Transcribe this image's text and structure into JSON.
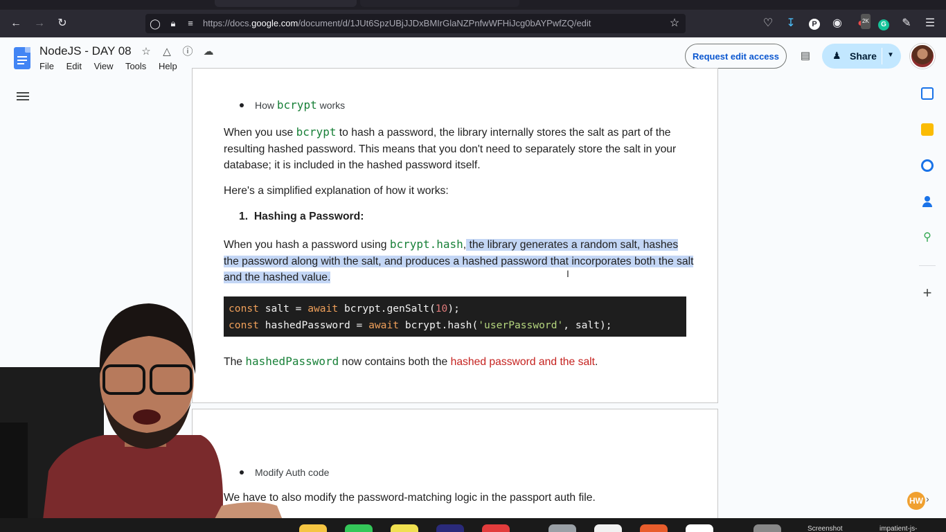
{
  "browser": {
    "url_prefix": "https://docs.",
    "url_domain": "google.com",
    "url_path": "/document/d/1JUt6SpzUBjJJDxBMIrGlaNZPnfwWFHiJcg0bAYPwfZQ/edit",
    "extension_badge": "2K"
  },
  "docs": {
    "title": "NodeJS - DAY 08",
    "menu": [
      "File",
      "Edit",
      "View",
      "Tools",
      "Help"
    ],
    "request_edit_label": "Request edit access",
    "share_label": "Share"
  },
  "content": {
    "bullet1_prefix": "How ",
    "bullet1_code": "bcrypt",
    "bullet1_suffix": " works",
    "p1_a": "When you use ",
    "p1_code": "bcrypt",
    "p1_b": " to hash a password, the library internally stores the salt as part of the resulting hashed password. This means that you don't need to separately store the salt in your database; it is included in the hashed password itself.",
    "p2": "Here's a simplified explanation of how it works:",
    "list_num": "1.",
    "list_item": "Hashing a Password:",
    "p3_a": "When you hash a password using ",
    "p3_code": "bcrypt.hash",
    "p3_b": ",",
    "p3_sel": " the library generates a random salt, hashes the password along with the salt, and produces a hashed password that incorporates both the salt and the hashed value.",
    "code_line1": {
      "kw1": "const",
      "mid1": " salt = ",
      "kw2": "await",
      "mid2": " bcrypt.genSalt(",
      "num": "10",
      "end": ");"
    },
    "code_line2": {
      "kw1": "const",
      "mid1": " hashedPassword = ",
      "kw2": "await",
      "mid2": " bcrypt.hash(",
      "str": "'userPassword'",
      "end": ", salt);"
    },
    "p4_a": "The ",
    "p4_code": "hashedPassword",
    "p4_b": " now contains both the ",
    "p4_red": "hashed password and the salt",
    "p4_c": ".",
    "bullet2": "Modify Auth code",
    "p5": "We have to also modify the password-matching logic in the passport auth file."
  },
  "dock": {
    "label1": "Screenshot",
    "label2": "impatient-js-"
  },
  "overlay": {
    "hw_badge": "HW"
  },
  "colors": {
    "share_bg": "#c2e7ff",
    "selection": "#c3d6f5",
    "code_bg": "#1e1e1e",
    "inline_code": "#188038",
    "emphasis_red": "#c5221f"
  }
}
